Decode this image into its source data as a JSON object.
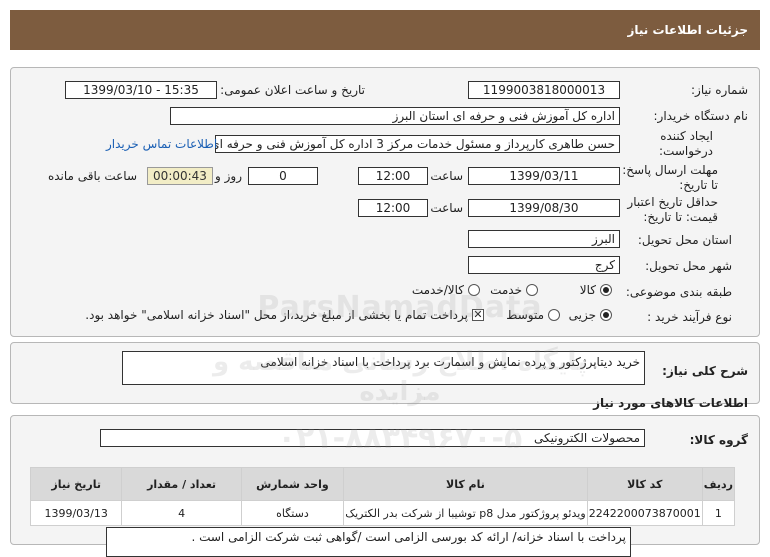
{
  "header": {
    "title": "جزئیات اطلاعات نیاز"
  },
  "fields": {
    "need_number_label": "شماره نیاز:",
    "need_number": "1199003818000013",
    "announce_label": "تاریخ و ساعت اعلان عمومی:",
    "announce_value": "1399/03/10 - 15:35",
    "buyer_label": "نام دستگاه خریدار:",
    "buyer_value": "اداره کل آموزش فنی و حرفه ای استان البرز",
    "creator_label_1": "ایجاد کننده",
    "creator_label_2": "درخواست:",
    "creator_value": "حسن  طاهری کارپرداز و مسئول خدمات مرکز 3 اداره کل آموزش فنی و حرفه ای",
    "contact_link": "اطلاعات تماس خریدار",
    "deadline_label_1": "مهلت ارسال پاسخ:",
    "deadline_label_2": "تا تاریخ:",
    "deadline_date": "1399/03/11",
    "time_label": "ساعت",
    "deadline_time": "12:00",
    "days_value": "0",
    "days_label": "روز و",
    "timer_value": "00:00:43",
    "remaining_label": "ساعت باقی مانده",
    "validity_label_1": "حداقل تاریخ اعتبار",
    "validity_label_2": "قیمت: تا تاریخ:",
    "validity_date": "1399/08/30",
    "validity_time": "12:00",
    "province_label": "استان محل تحویل:",
    "province_value": "البرز",
    "city_label": "شهر محل تحویل:",
    "city_value": "کرج",
    "category_label": "طبقه بندی موضوعی:",
    "category_options": [
      "کالا",
      "خدمت",
      "کالا/خدمت"
    ],
    "process_label": "نوع فرآیند خرید :",
    "process_options": [
      "جزیی",
      "متوسط"
    ],
    "payment_note": "پرداخت تمام یا بخشی از مبلغ خرید،از محل \"اسناد خزانه اسلامی\" خواهد بود.",
    "checkbox_mark": "✕"
  },
  "summary": {
    "label": "شرح کلی نیاز:",
    "value": "خرید دیتاپرژکتور و پرده نمایش و اسمارت برد پرداخت با اسناد خزانه اسلامی"
  },
  "goods": {
    "section_title": "اطلاعات کالاهای مورد نیاز",
    "group_label": "گروه کالا:",
    "group_value": "محصولات الکترونیکی",
    "columns": [
      "ردیف",
      "کد کالا",
      "نام کالا",
      "واحد شمارش",
      "تعداد / مقدار",
      "تاریخ نیاز"
    ],
    "rows": [
      [
        "1",
        "2242200073870001",
        "ویدئو پروژکتور مدل p8 توشیبا از شرکت بدر الکتریک",
        "دستگاه",
        "4",
        "1399/03/13"
      ]
    ]
  },
  "notes": {
    "line1": "پرداخت با اسناد خزانه/ ارائه کد بورسی الزامی است /گواهی ثبت شرکت الزامی است ."
  },
  "watermark": {
    "brand": "ParsNamadData",
    "line1": "پایگاه اطلاع رسانی مناقصه و مزایده",
    "phone": "۰۲۱-۸۸۳۴۹۶۷۰-۵"
  }
}
